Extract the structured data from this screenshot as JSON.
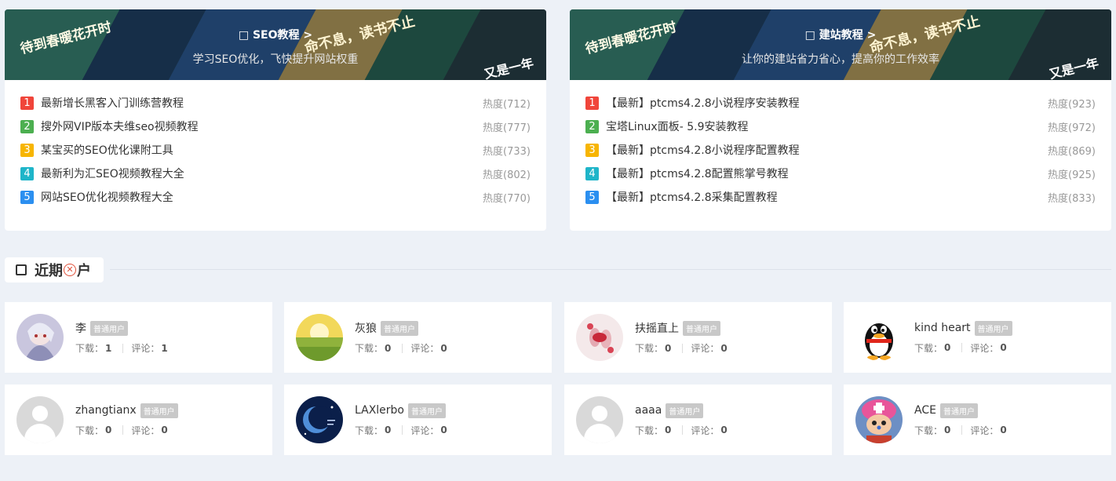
{
  "cards": [
    {
      "title": "□ SEO教程 >",
      "subtitle": "学习SEO优化，飞快提升网站权重",
      "items": [
        {
          "rank": "1",
          "text": "最新增长黑客入门训练营教程",
          "heat": "热度(712)"
        },
        {
          "rank": "2",
          "text": "搜外网VIP版本夫维seo视频教程",
          "heat": "热度(777)"
        },
        {
          "rank": "3",
          "text": "某宝买的SEO优化课附工具",
          "heat": "热度(733)"
        },
        {
          "rank": "4",
          "text": "最新利为汇SEO视频教程大全",
          "heat": "热度(802)"
        },
        {
          "rank": "5",
          "text": "网站SEO优化视频教程大全",
          "heat": "热度(770)"
        }
      ]
    },
    {
      "title": "□ 建站教程 >",
      "subtitle": "让你的建站省力省心，提高你的工作效率",
      "items": [
        {
          "rank": "1",
          "text": "【最新】ptcms4.2.8小说程序安装教程",
          "heat": "热度(923)"
        },
        {
          "rank": "2",
          "text": "宝塔Linux面板- 5.9安装教程",
          "heat": "热度(972)"
        },
        {
          "rank": "3",
          "text": "【最新】ptcms4.2.8小说程序配置教程",
          "heat": "热度(869)"
        },
        {
          "rank": "4",
          "text": "【最新】ptcms4.2.8配置熊掌号教程",
          "heat": "热度(925)"
        },
        {
          "rank": "5",
          "text": "【最新】ptcms4.2.8采集配置教程",
          "heat": "热度(833)"
        }
      ]
    }
  ],
  "banner_text": {
    "deco1": "待到春暖花开时",
    "deco2": "命不息，读书不止",
    "deco3": "又是一年"
  },
  "rank_colors": [
    "#f0453a",
    "#4caf50",
    "#f7b500",
    "#1fb5c9",
    "#2b8ff0"
  ],
  "section": {
    "title_before": "近期",
    "title_after": "户"
  },
  "labels": {
    "badge": "普通用户",
    "download": "下载：",
    "comment": "评论："
  },
  "users": [
    {
      "name": "李",
      "downloads": "1",
      "comments": "1",
      "avatar": "anime-girl"
    },
    {
      "name": "灰狼",
      "downloads": "0",
      "comments": "0",
      "avatar": "grass-field"
    },
    {
      "name": "扶摇直上",
      "downloads": "0",
      "comments": "0",
      "avatar": "nails"
    },
    {
      "name": "kind heart",
      "downloads": "0",
      "comments": "0",
      "avatar": "qq-penguin"
    },
    {
      "name": "zhangtianx",
      "downloads": "0",
      "comments": "0",
      "avatar": "default-user"
    },
    {
      "name": "LAXlerbo",
      "downloads": "0",
      "comments": "0",
      "avatar": "blue-moon"
    },
    {
      "name": "aaaa",
      "downloads": "0",
      "comments": "0",
      "avatar": "default-user"
    },
    {
      "name": "ACE",
      "downloads": "0",
      "comments": "0",
      "avatar": "chopper"
    }
  ]
}
